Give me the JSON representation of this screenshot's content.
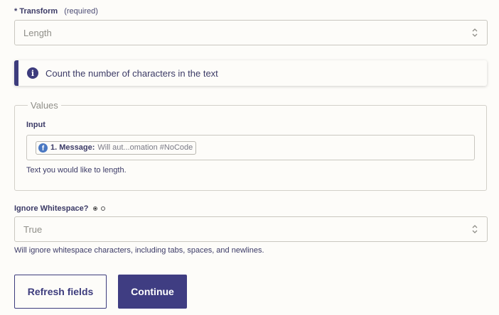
{
  "transform": {
    "star": "*",
    "label": "Transform",
    "required_note": "(required)",
    "value": "Length"
  },
  "info": {
    "icon": "info-icon",
    "text": "Count the number of characters in the text"
  },
  "values": {
    "legend": "Values",
    "input_label": "Input",
    "chip": {
      "icon": "facebook-icon",
      "strong": "1. Message:",
      "muted": "Will aut...omation #NoCode"
    },
    "help": "Text you would like to length."
  },
  "ignore_whitespace": {
    "label": "Ignore Whitespace?",
    "value": "True",
    "help": "Will ignore whitespace characters, including tabs, spaces, and newlines."
  },
  "buttons": {
    "refresh": "Refresh fields",
    "continue": "Continue"
  },
  "colors": {
    "accent": "#3d3c7d",
    "background": "#fdfcf9",
    "border": "#c9c7c0"
  }
}
